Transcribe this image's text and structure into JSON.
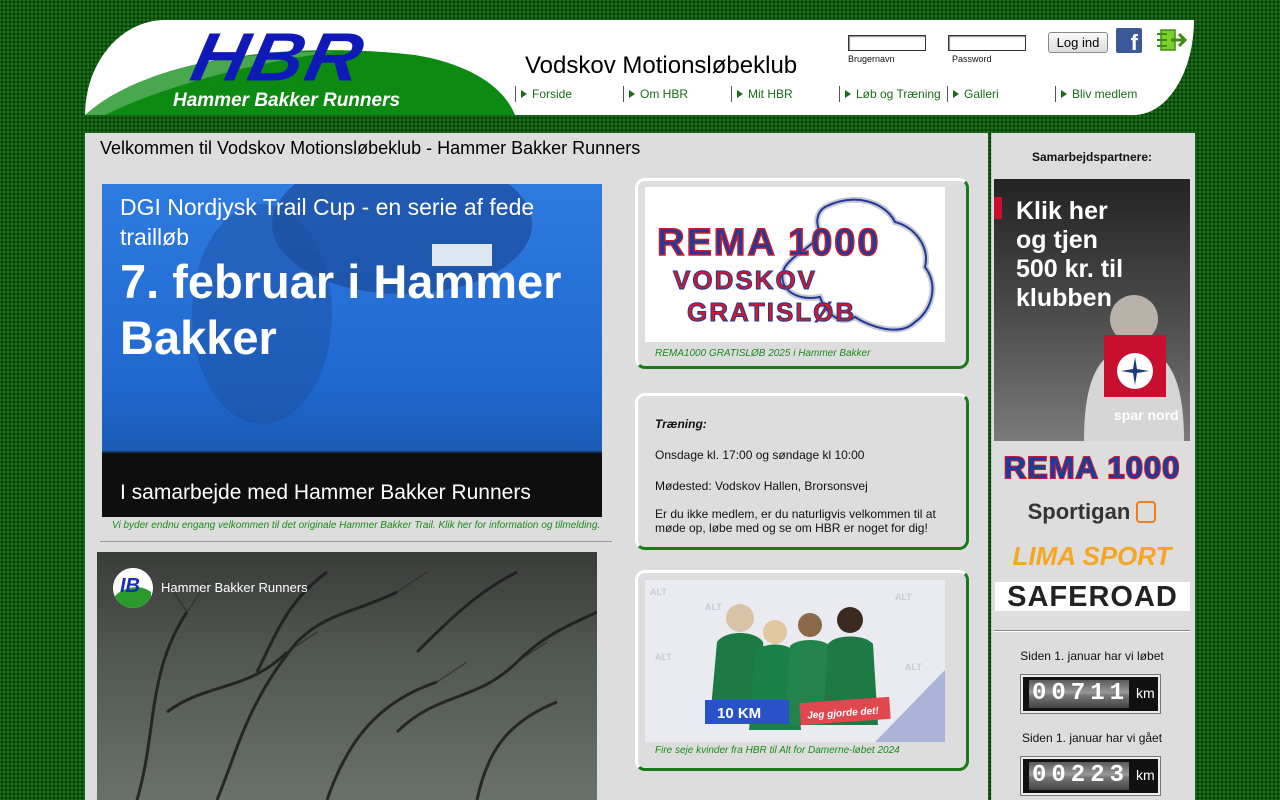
{
  "header": {
    "logo_text": "HBR",
    "logo_subtitle": "Hammer Bakker Runners",
    "site_title": "Vodskov Motionsløbeklub",
    "login": {
      "username_label": "Brugernavn",
      "password_label": "Password",
      "button_label": "Log ind"
    }
  },
  "nav": {
    "items": [
      {
        "label": "Forside"
      },
      {
        "label": "Om HBR"
      },
      {
        "label": "Mit HBR"
      },
      {
        "label": "Løb og Træning"
      },
      {
        "label": "Galleri"
      },
      {
        "label": "Bliv medlem"
      }
    ]
  },
  "main": {
    "title": "Velkommen til Vodskov Motionsløbeklub - Hammer Bakker Runners",
    "hero": {
      "line1": "DGI Nordjysk Trail Cup - en serie af fede trailløb",
      "line2": "7. februar i Hammer Bakker",
      "line3": "I samarbejde med Hammer Bakker Runners",
      "caption": "Vi byder endnu engang velkommen til det originale Hammer Bakker Trail. Klik her for information og tilmelding."
    },
    "video": {
      "channel_name": "Hammer Bakker Runners"
    },
    "rema_card": {
      "image_line1": "REMA 1000",
      "image_line2": "VODSKOV",
      "image_line3": "GRATISLØB",
      "caption": "REMA1000 GRATISLØB 2025 i Hammer Bakker"
    },
    "training_card": {
      "heading": "Træning:",
      "schedule": "Onsdage kl. 17:00 og søndage kl 10:00",
      "meeting_point": "Mødested: Vodskov Hallen, Brorsonsvej",
      "invitation": "Er du ikke medlem, er du naturligvis velkommen til at møde op, løbe med og se om HBR er noget for dig!"
    },
    "photo_card": {
      "sign_left": "10 KM",
      "sign_right": "Jeg gjorde det!",
      "caption": "Fire seje kvinder fra HBR til Alt for Damerne-løbet 2024"
    }
  },
  "sidebar": {
    "partners_title": "Samarbejdspartnere:",
    "sparnord_ad": {
      "text": "Klik her og tjen 500 kr. til klubben",
      "brand": "spar nord"
    },
    "partners": [
      "REMA 1000",
      "Sportigan",
      "LIMA SPORT",
      "SAFEROAD"
    ],
    "counters": [
      {
        "label": "Siden 1. januar har vi løbet",
        "value": "00711",
        "unit": "km"
      },
      {
        "label": "Siden 1. januar har vi gået",
        "value": "00223",
        "unit": "km"
      }
    ]
  },
  "colors": {
    "brand_green": "#1a7a1a",
    "logo_blue": "#0f19b8",
    "rema_blue": "#1f3a9a",
    "rema_red": "#d01a2a",
    "sparnord_red": "#c8102e"
  },
  "icons": [
    "facebook-icon",
    "exit-icon",
    "nav-arrow-icon",
    "play-video-icon"
  ]
}
